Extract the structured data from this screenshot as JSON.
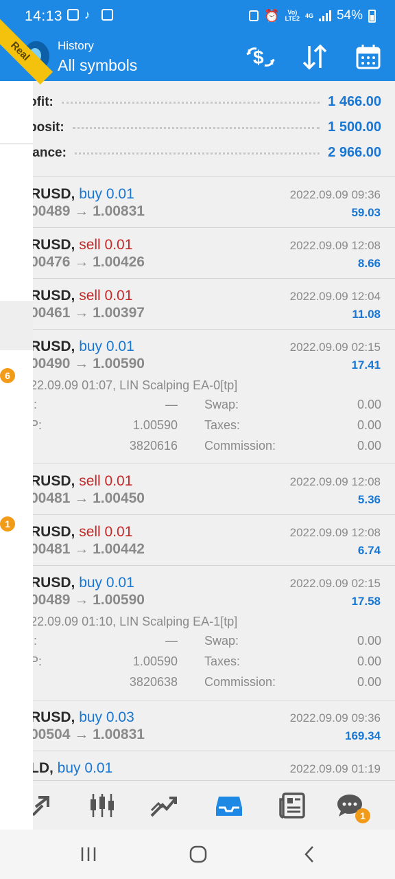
{
  "status_bar": {
    "time": "14:13",
    "network_top": "Vo)",
    "network_bottom": "LTE2",
    "net_type": "4G",
    "battery": "54%"
  },
  "toolbar": {
    "title_small": "History",
    "title_big": "All symbols",
    "account_badge": "Real",
    "buttons": [
      "currency-exchange-icon",
      "sort-icon",
      "calendar-icon"
    ]
  },
  "summary": {
    "profit_label": "ofit:",
    "profit_value": "1 466.00",
    "deposit_label": "posit:",
    "deposit_value": "1 500.00",
    "balance_label": "lance:",
    "balance_value": "2 966.00"
  },
  "trades": [
    {
      "symbol": "RUSD,",
      "side": "buy",
      "volume": "0.01",
      "price": "00489 → 1.00831",
      "time": "2022.09.09 09:36",
      "profit": "59.03"
    },
    {
      "symbol": "RUSD,",
      "side": "sell",
      "volume": "0.01",
      "price": "00476 → 1.00426",
      "time": "2022.09.09 12:08",
      "profit": "8.66"
    },
    {
      "symbol": "RUSD,",
      "side": "sell",
      "volume": "0.01",
      "price": "00461 → 1.00397",
      "time": "2022.09.09 12:04",
      "profit": "11.08"
    },
    {
      "symbol": "RUSD,",
      "side": "buy",
      "volume": "0.01",
      "price": "00490 → 1.00590",
      "time": "2022.09.09 02:15",
      "profit": "17.41",
      "details": {
        "line": "22.09.09 01:07, LIN Scalping EA-0[tp]",
        "sl_label": ".:",
        "sl_value": "—",
        "tp_label": "P:",
        "tp_value": "1.00590",
        "id_value": "3820616",
        "swap_label": "Swap:",
        "swap_value": "0.00",
        "taxes_label": "Taxes:",
        "taxes_value": "0.00",
        "commission_label": "Commission:",
        "commission_value": "0.00"
      }
    },
    {
      "symbol": "RUSD,",
      "side": "sell",
      "volume": "0.01",
      "price": "00481 → 1.00450",
      "time": "2022.09.09 12:08",
      "profit": "5.36"
    },
    {
      "symbol": "RUSD,",
      "side": "sell",
      "volume": "0.01",
      "price": "00481 → 1.00442",
      "time": "2022.09.09 12:08",
      "profit": "6.74"
    },
    {
      "symbol": "RUSD,",
      "side": "buy",
      "volume": "0.01",
      "price": "00489 → 1.00590",
      "time": "2022.09.09 02:15",
      "profit": "17.58",
      "details": {
        "line": "22.09.09 01:10, LIN Scalping EA-1[tp]",
        "sl_label": ".:",
        "sl_value": "—",
        "tp_label": "P:",
        "tp_value": "1.00590",
        "id_value": "3820638",
        "swap_label": "Swap:",
        "swap_value": "0.00",
        "taxes_label": "Taxes:",
        "taxes_value": "0.00",
        "commission_label": "Commission:",
        "commission_value": "0.00"
      }
    },
    {
      "symbol": "RUSD,",
      "side": "buy",
      "volume": "0.03",
      "price": "00504 → 1.00831",
      "time": "2022.09.09 09:36",
      "profit": "169.34"
    },
    {
      "symbol": "LD,",
      "side": "buy",
      "volume": "0.01",
      "price": "",
      "time": "2022.09.09 01:19",
      "profit": ""
    }
  ],
  "drawer": {
    "badge_a": "6",
    "badge_b": "1"
  },
  "bottom_nav": {
    "chat_badge": "1"
  },
  "colors": {
    "primary": "#1e88e5",
    "buy": "#1976d2",
    "sell": "#c62828",
    "badge": "#f29b18",
    "ribbon": "#f4c20d"
  }
}
